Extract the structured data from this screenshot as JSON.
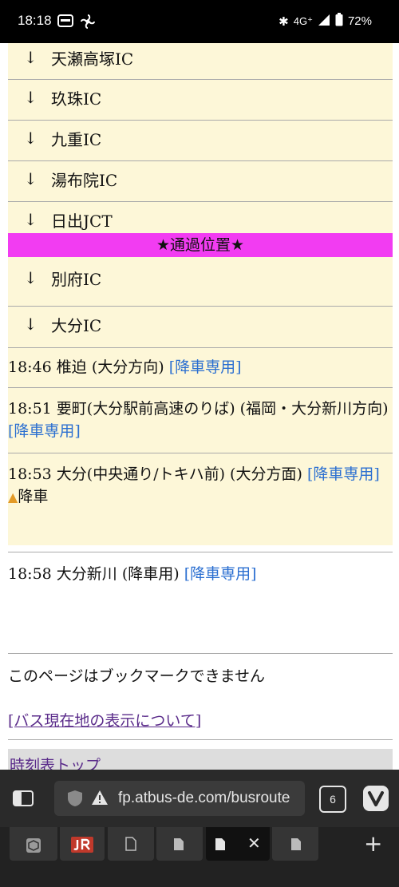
{
  "status": {
    "time": "18:18",
    "network": "4G⁺",
    "battery": "72%"
  },
  "route": {
    "stops": [
      {
        "arrow": "↓",
        "name": "天瀬高塚IC"
      },
      {
        "arrow": "↓",
        "name": "玖珠IC"
      },
      {
        "arrow": "↓",
        "name": "九重IC"
      },
      {
        "arrow": "↓",
        "name": "湯布院IC"
      },
      {
        "arrow": "↓",
        "name": "日出JCT"
      }
    ],
    "pass_label": "★通過位置★",
    "stops_after": [
      {
        "arrow": "↓",
        "name": "別府IC"
      },
      {
        "arrow": "↓",
        "name": "大分IC"
      }
    ],
    "entries": [
      {
        "text": "18:46 椎迫 (大分方向) ",
        "link": "[降車専用]"
      },
      {
        "text": "18:51 要町(大分駅前高速のりば) (福岡・大分新川方向) ",
        "link": "[降車専用]"
      },
      {
        "text": "18:53 大分(中央通り/トキハ前) (大分方面) ",
        "link": "[降車専用]",
        "note_mark": "▲",
        "note": "降車"
      }
    ]
  },
  "after_entry": {
    "text": "18:58 大分新川 (降車用) ",
    "link": "[降車専用]"
  },
  "bookmark_note": "このページはブックマークできません",
  "bus_location_link": "[バス現在地の表示について]",
  "timetable_top_link": "時刻表トップ",
  "browser": {
    "url": "fp.atbus-de.com/busroute",
    "tab_count": "6"
  }
}
